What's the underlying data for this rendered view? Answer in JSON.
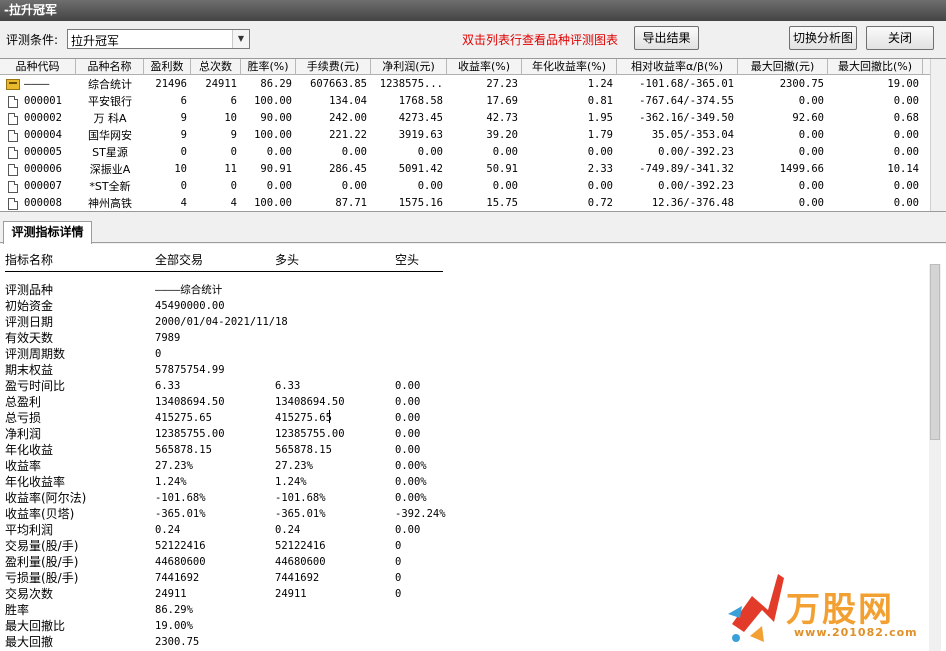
{
  "window": {
    "title": "-拉升冠军"
  },
  "toolbar": {
    "condition_label": "评测条件:",
    "condition_value": "拉升冠军",
    "hint": "双击列表行查看品种评测图表",
    "export_label": "导出结果",
    "switch_label": "切换分析图",
    "close_label": "关闭"
  },
  "list": {
    "columns": [
      "品种代码",
      "品种名称",
      "盈利数",
      "总次数",
      "胜率(%)",
      "手续费(元)",
      "净利润(元)",
      "收益率(%)",
      "年化收益率(%)",
      "相对收益率α/β(%)",
      "最大回撤(元)",
      "最大回撤比(%)"
    ],
    "rows": [
      {
        "code": "————",
        "name": "综合统计",
        "win": "21496",
        "total": "24911",
        "rate": "86.29",
        "fee": "607663.85",
        "profit": "1238575...",
        "ret": "27.23",
        "annual": "1.24",
        "rel": "-101.68/-365.01",
        "maxdd": "2300.75",
        "maxddp": "19.00",
        "icon": "summary-icon"
      },
      {
        "code": "000001",
        "name": "平安银行",
        "win": "6",
        "total": "6",
        "rate": "100.00",
        "fee": "134.04",
        "profit": "1768.58",
        "ret": "17.69",
        "annual": "0.81",
        "rel": "-767.64/-374.55",
        "maxdd": "0.00",
        "maxddp": "0.00",
        "icon": "document-icon"
      },
      {
        "code": "000002",
        "name": "万 科A",
        "win": "9",
        "total": "10",
        "rate": "90.00",
        "fee": "242.00",
        "profit": "4273.45",
        "ret": "42.73",
        "annual": "1.95",
        "rel": "-362.16/-349.50",
        "maxdd": "92.60",
        "maxddp": "0.68",
        "icon": "document-icon"
      },
      {
        "code": "000004",
        "name": "国华网安",
        "win": "9",
        "total": "9",
        "rate": "100.00",
        "fee": "221.22",
        "profit": "3919.63",
        "ret": "39.20",
        "annual": "1.79",
        "rel": "35.05/-353.04",
        "maxdd": "0.00",
        "maxddp": "0.00",
        "icon": "document-icon"
      },
      {
        "code": "000005",
        "name": "ST星源",
        "win": "0",
        "total": "0",
        "rate": "0.00",
        "fee": "0.00",
        "profit": "0.00",
        "ret": "0.00",
        "annual": "0.00",
        "rel": "0.00/-392.23",
        "maxdd": "0.00",
        "maxddp": "0.00",
        "icon": "document-icon"
      },
      {
        "code": "000006",
        "name": "深振业A",
        "win": "10",
        "total": "11",
        "rate": "90.91",
        "fee": "286.45",
        "profit": "5091.42",
        "ret": "50.91",
        "annual": "2.33",
        "rel": "-749.89/-341.32",
        "maxdd": "1499.66",
        "maxddp": "10.14",
        "icon": "document-icon"
      },
      {
        "code": "000007",
        "name": "*ST全新",
        "win": "0",
        "total": "0",
        "rate": "0.00",
        "fee": "0.00",
        "profit": "0.00",
        "ret": "0.00",
        "annual": "0.00",
        "rel": "0.00/-392.23",
        "maxdd": "0.00",
        "maxddp": "0.00",
        "icon": "document-icon"
      },
      {
        "code": "000008",
        "name": "神州高铁",
        "win": "4",
        "total": "4",
        "rate": "100.00",
        "fee": "87.71",
        "profit": "1575.16",
        "ret": "15.75",
        "annual": "0.72",
        "rel": "12.36/-376.48",
        "maxdd": "0.00",
        "maxddp": "0.00",
        "icon": "document-icon"
      }
    ]
  },
  "tab": {
    "label": "评测指标详情"
  },
  "detail": {
    "headers": [
      "指标名称",
      "全部交易",
      "多头",
      "空头"
    ],
    "rows": [
      {
        "k": "评测品种",
        "a": "————综合统计",
        "b": "",
        "c": ""
      },
      {
        "k": "初始资金",
        "a": "45490000.00",
        "b": "",
        "c": ""
      },
      {
        "k": "评测日期",
        "a": "2000/01/04-2021/11/18",
        "b": "",
        "c": ""
      },
      {
        "k": "有效天数",
        "a": "7989",
        "b": "",
        "c": ""
      },
      {
        "k": "评测周期数",
        "a": "0",
        "b": "",
        "c": ""
      },
      {
        "k": "期末权益",
        "a": "57875754.99",
        "b": "",
        "c": ""
      },
      {
        "k": "盈亏时间比",
        "a": "6.33",
        "b": "6.33",
        "c": "0.00"
      },
      {
        "k": "总盈利",
        "a": "13408694.50",
        "b": "13408694.50",
        "c": "0.00"
      },
      {
        "k": "总亏损",
        "a": "415275.65",
        "b": "415275.65",
        "c": "0.00"
      },
      {
        "k": "净利润",
        "a": "12385755.00",
        "b": "12385755.00",
        "c": "0.00"
      },
      {
        "k": "年化收益",
        "a": "565878.15",
        "b": "565878.15",
        "c": "0.00"
      },
      {
        "k": "收益率",
        "a": "27.23%",
        "b": "27.23%",
        "c": "0.00%"
      },
      {
        "k": "年化收益率",
        "a": "1.24%",
        "b": "1.24%",
        "c": "0.00%"
      },
      {
        "k": "收益率(阿尔法)",
        "a": "-101.68%",
        "b": "-101.68%",
        "c": "0.00%"
      },
      {
        "k": "收益率(贝塔)",
        "a": "-365.01%",
        "b": "-365.01%",
        "c": "-392.24%"
      },
      {
        "k": "平均利润",
        "a": "0.24",
        "b": "0.24",
        "c": "0.00"
      },
      {
        "k": "交易量(股/手)",
        "a": "52122416",
        "b": "52122416",
        "c": "0"
      },
      {
        "k": "盈利量(股/手)",
        "a": "44680600",
        "b": "44680600",
        "c": "0"
      },
      {
        "k": "亏损量(股/手)",
        "a": "7441692",
        "b": "7441692",
        "c": "0"
      },
      {
        "k": "交易次数",
        "a": "24911",
        "b": "24911",
        "c": "0"
      },
      {
        "k": "胜率",
        "a": "86.29%",
        "b": "",
        "c": ""
      },
      {
        "k": "最大回撤比",
        "a": "19.00%",
        "b": "",
        "c": ""
      },
      {
        "k": "最大回撤",
        "a": "2300.75",
        "b": "",
        "c": ""
      }
    ]
  },
  "watermark": {
    "brand": "万股网",
    "url": "www.201082.com"
  }
}
